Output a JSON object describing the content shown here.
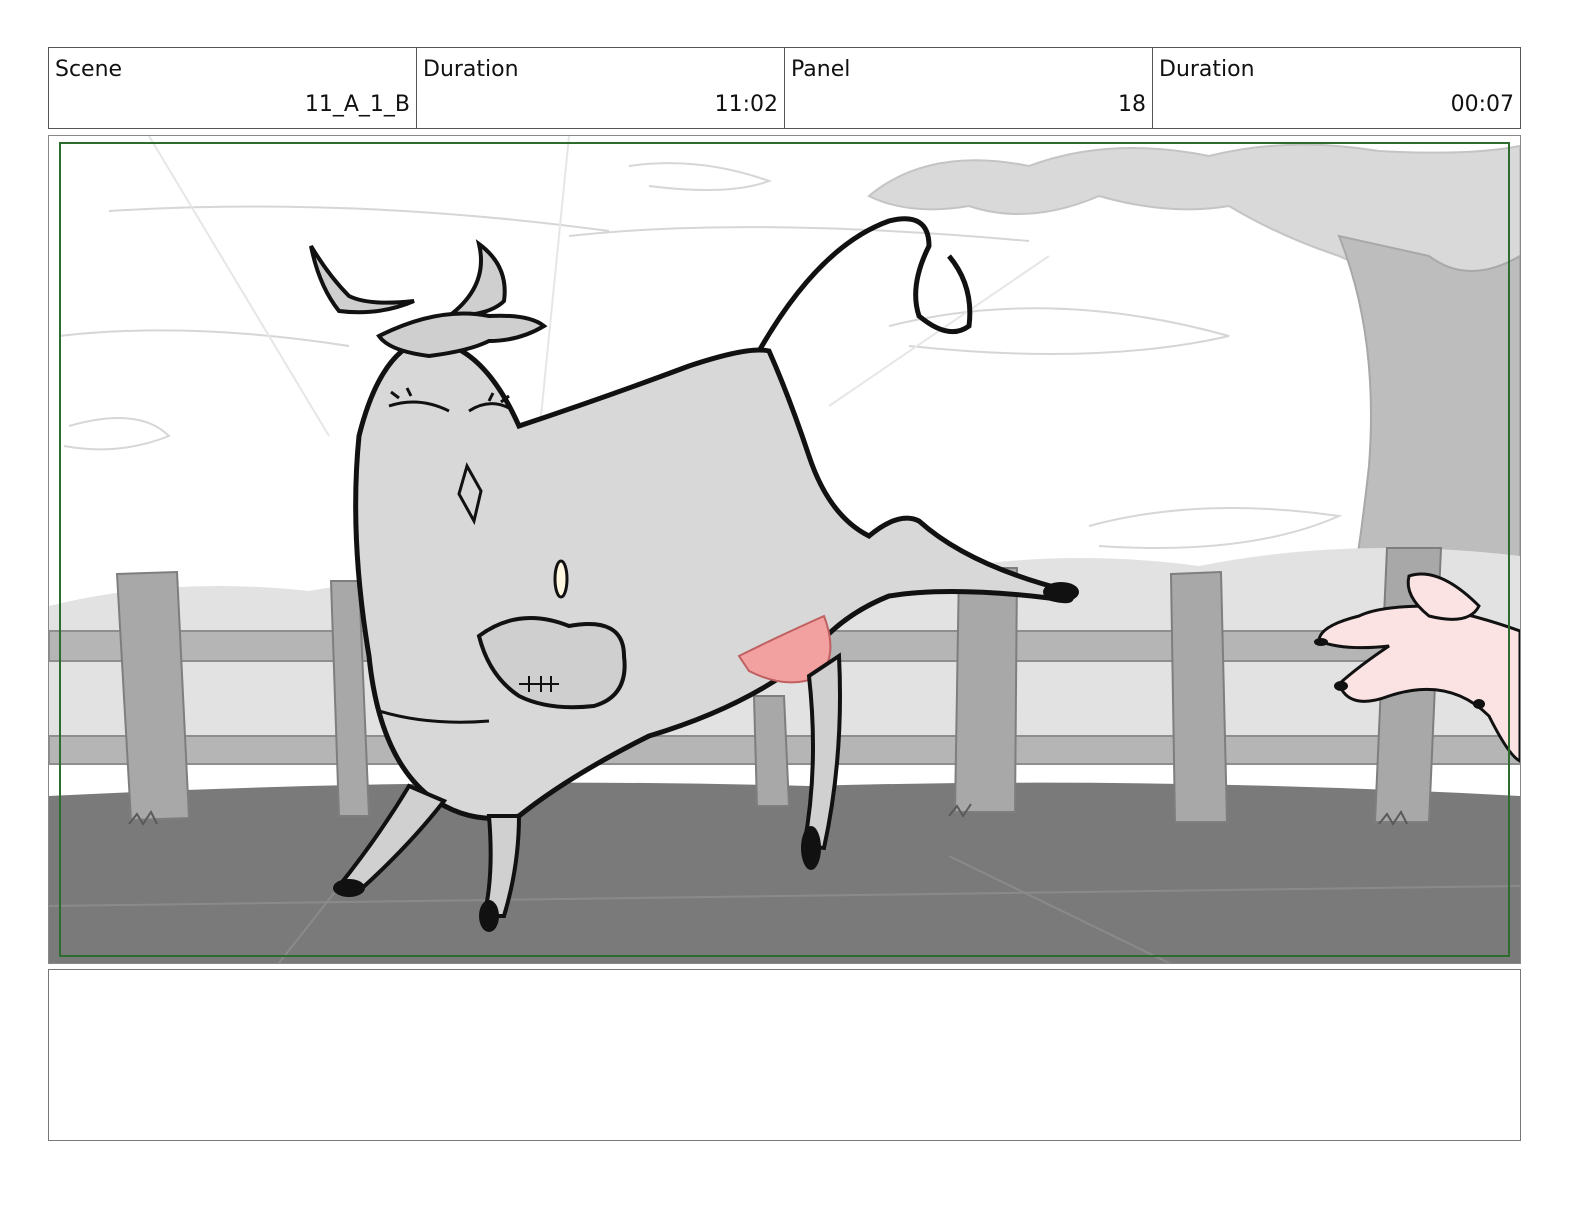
{
  "header": {
    "scene": {
      "label": "Scene",
      "value": "11_A_1_B"
    },
    "scene_duration": {
      "label": "Duration",
      "value": "11:02"
    },
    "panel": {
      "label": "Panel",
      "value": "18"
    },
    "panel_duration": {
      "label": "Duration",
      "value": "00:07"
    }
  },
  "notes": {
    "text": ""
  },
  "colors": {
    "safe_frame": "#2e6b2e",
    "ground": "#7a7a7a",
    "fence": "#a8a8a8",
    "cow_body": "#d8d8d8",
    "udder": "#f2a0a0",
    "hand": "#fbe3e3"
  }
}
